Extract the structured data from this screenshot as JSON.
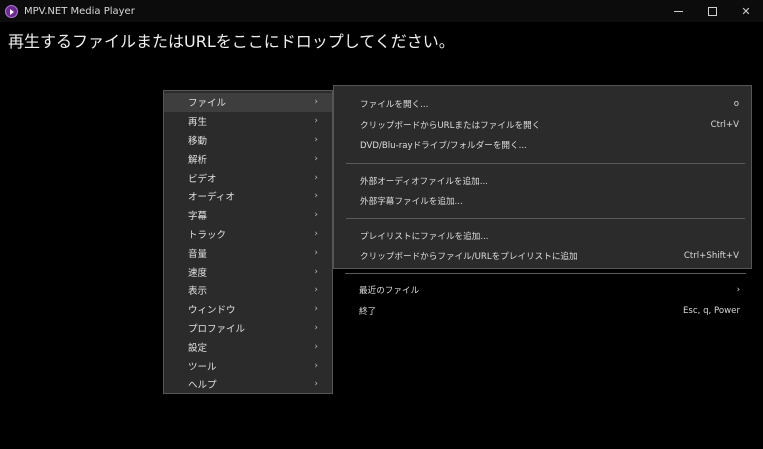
{
  "window": {
    "title": "MPV.NET Media Player",
    "minimize": "",
    "maximize": "",
    "close": "✕"
  },
  "drop_message": "再生するファイルまたはURLをここにドロップしてください。",
  "main_menu": {
    "items": [
      {
        "label": "ファイル",
        "arrow": "›"
      },
      {
        "label": "再生",
        "arrow": "›"
      },
      {
        "label": "移動",
        "arrow": "›"
      },
      {
        "label": "解析",
        "arrow": "›"
      },
      {
        "label": "ビデオ",
        "arrow": "›"
      },
      {
        "label": "オーディオ",
        "arrow": "›"
      },
      {
        "label": "字幕",
        "arrow": "›"
      },
      {
        "label": "トラック",
        "arrow": "›"
      },
      {
        "label": "音量",
        "arrow": "›"
      },
      {
        "label": "速度",
        "arrow": "›"
      },
      {
        "label": "表示",
        "arrow": "›"
      },
      {
        "label": "ウィンドウ",
        "arrow": "›"
      },
      {
        "label": "プロファイル",
        "arrow": "›"
      },
      {
        "label": "設定",
        "arrow": "›"
      },
      {
        "label": "ツール",
        "arrow": "›"
      },
      {
        "label": "ヘルプ",
        "arrow": "›"
      }
    ]
  },
  "file_menu": {
    "items": [
      {
        "label": "ファイルを開く...",
        "shortcut": "o"
      },
      {
        "label": "クリップボードからURLまたはファイルを開く",
        "shortcut": "Ctrl+V"
      },
      {
        "label": "DVD/Blu-rayドライブ/フォルダーを開く...",
        "shortcut": ""
      },
      {
        "label": "外部オーディオファイルを追加...",
        "shortcut": ""
      },
      {
        "label": "外部字幕ファイルを追加...",
        "shortcut": ""
      },
      {
        "label": "プレイリストにファイルを追加...",
        "shortcut": ""
      },
      {
        "label": "クリップボードからファイル/URLをプレイリストに追加",
        "shortcut": "Ctrl+Shift+V"
      },
      {
        "label": "最近のファイル",
        "shortcut": "›"
      },
      {
        "label": "終了",
        "shortcut": "Esc, q, Power"
      }
    ]
  }
}
